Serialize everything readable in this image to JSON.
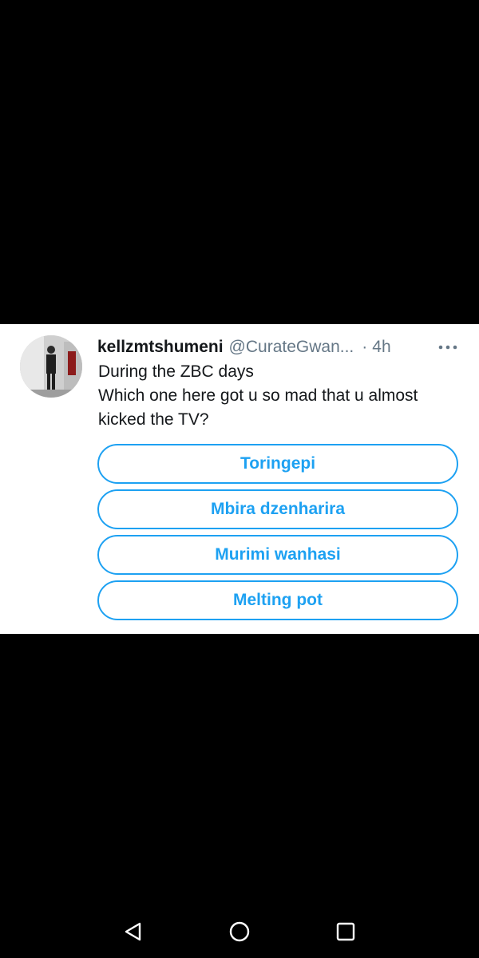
{
  "tweet": {
    "display_name": "kellzmtshumeni",
    "handle": "@CurateGwan...",
    "separator": "·",
    "time": "4h",
    "text_lines": [
      "During the ZBC days",
      "Which one here got u so mad that u almost",
      "kicked the TV?"
    ],
    "more_icon": "more-horizontal-icon"
  },
  "poll": {
    "options": [
      "Toringepi",
      "Mbira dzenharira",
      "Murimi wanhasi",
      "Melting pot"
    ]
  },
  "navigation": {
    "back_icon": "triangle-back-icon",
    "home_icon": "circle-home-icon",
    "recents_icon": "square-recents-icon"
  },
  "colors": {
    "accent": "#1da1f2",
    "background": "#000000",
    "card": "#ffffff",
    "secondary_text": "#657786"
  }
}
